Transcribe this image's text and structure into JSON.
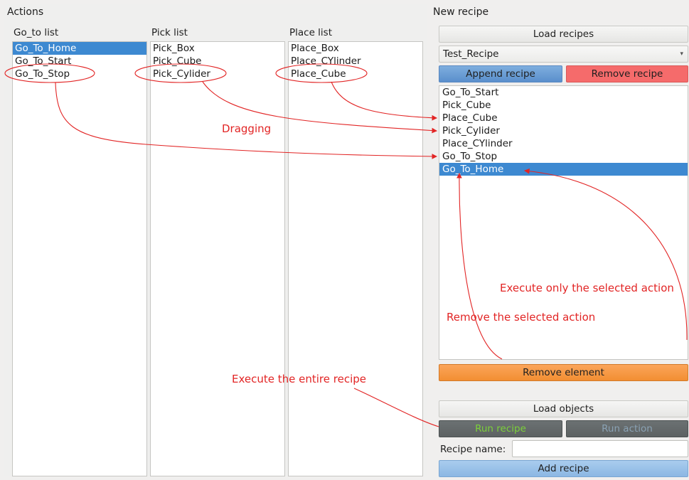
{
  "actions": {
    "title": "Actions",
    "goto_list": {
      "label": "Go_to list",
      "items": [
        "Go_To_Home",
        "Go_To_Start",
        "Go_To_Stop"
      ]
    },
    "pick_list": {
      "label": "Pick list",
      "items": [
        "Pick_Box",
        "Pick_Cube",
        "Pick_Cylider"
      ]
    },
    "place_list": {
      "label": "Place list",
      "items": [
        "Place_Box",
        "Place_CYlinder",
        "Place_Cube"
      ]
    }
  },
  "new_recipe": {
    "title": "New recipe",
    "load_recipes": "Load recipes",
    "recipe_select": "Test_Recipe",
    "append_recipe": "Append recipe",
    "remove_recipe": "Remove recipe",
    "recipe_items": [
      "Go_To_Start",
      "Pick_Cube",
      "Place_Cube",
      "Pick_Cylider",
      "Place_CYlinder",
      "Go_To_Stop",
      "Go_To_Home"
    ],
    "remove_element": "Remove element",
    "load_objects": "Load objects",
    "run_recipe": "Run recipe",
    "run_action": "Run action",
    "recipe_name_label": "Recipe name:",
    "recipe_name_value": "",
    "add_recipe": "Add recipe"
  },
  "annotations": {
    "dragging": "Dragging",
    "execute_selected": "Execute only the selected action",
    "remove_selected": "Remove the selected action",
    "execute_entire": "Execute the entire recipe"
  },
  "colors": {
    "selection": "#3d89d1",
    "annotation_red": "#e22525",
    "run_recipe_text": "#7cd13a",
    "run_action_text": "#8aa2b4"
  }
}
